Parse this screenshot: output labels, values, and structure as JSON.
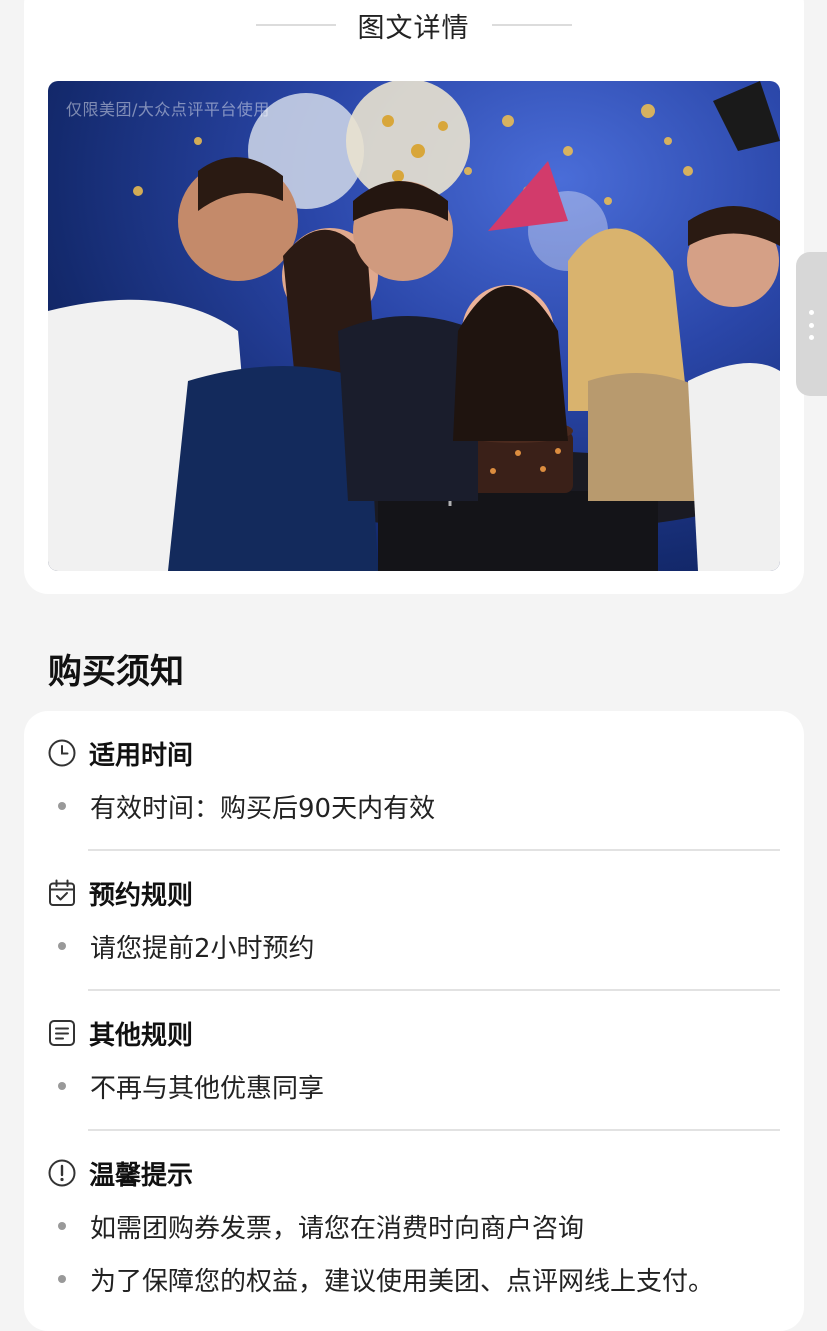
{
  "detail": {
    "title": "图文详情",
    "watermark": "仅限美团/大众点评平台使用"
  },
  "notice": {
    "heading": "购买须知",
    "sections": [
      {
        "icon": "clock-icon",
        "title": "适用时间",
        "items": [
          "有效时间：购买后90天内有效"
        ]
      },
      {
        "icon": "calendar-check-icon",
        "title": "预约规则",
        "items": [
          "请您提前2小时预约"
        ]
      },
      {
        "icon": "document-icon",
        "title": "其他规则",
        "items": [
          "不再与其他优惠同享"
        ]
      },
      {
        "icon": "exclamation-circle-icon",
        "title": "温馨提示",
        "items": [
          "如需团购券发票，请您在消费时向商户咨询",
          "为了保障您的权益，建议使用美团、点评网线上支付。"
        ]
      }
    ]
  }
}
